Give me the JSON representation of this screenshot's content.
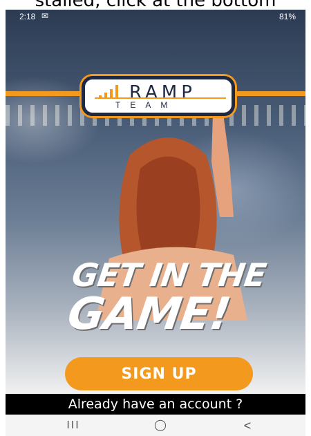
{
  "caption": {
    "text": "stalled, click at the bottom"
  },
  "status_bar": {
    "time": "2:18",
    "mail_icon": "mail-icon",
    "right": "81%"
  },
  "logo": {
    "ramp": "RAMP",
    "team": "TEAM"
  },
  "hero": {
    "line1": "GET IN THE",
    "line2": "GAME!"
  },
  "signup": {
    "label": "SIGN UP"
  },
  "account": {
    "label": "Already have an account ?"
  },
  "nav": {
    "recents": "III",
    "home": "◯",
    "back": "<"
  },
  "colors": {
    "accent": "#f39a1e",
    "navy": "#1e2a44",
    "bar": "#000000"
  }
}
